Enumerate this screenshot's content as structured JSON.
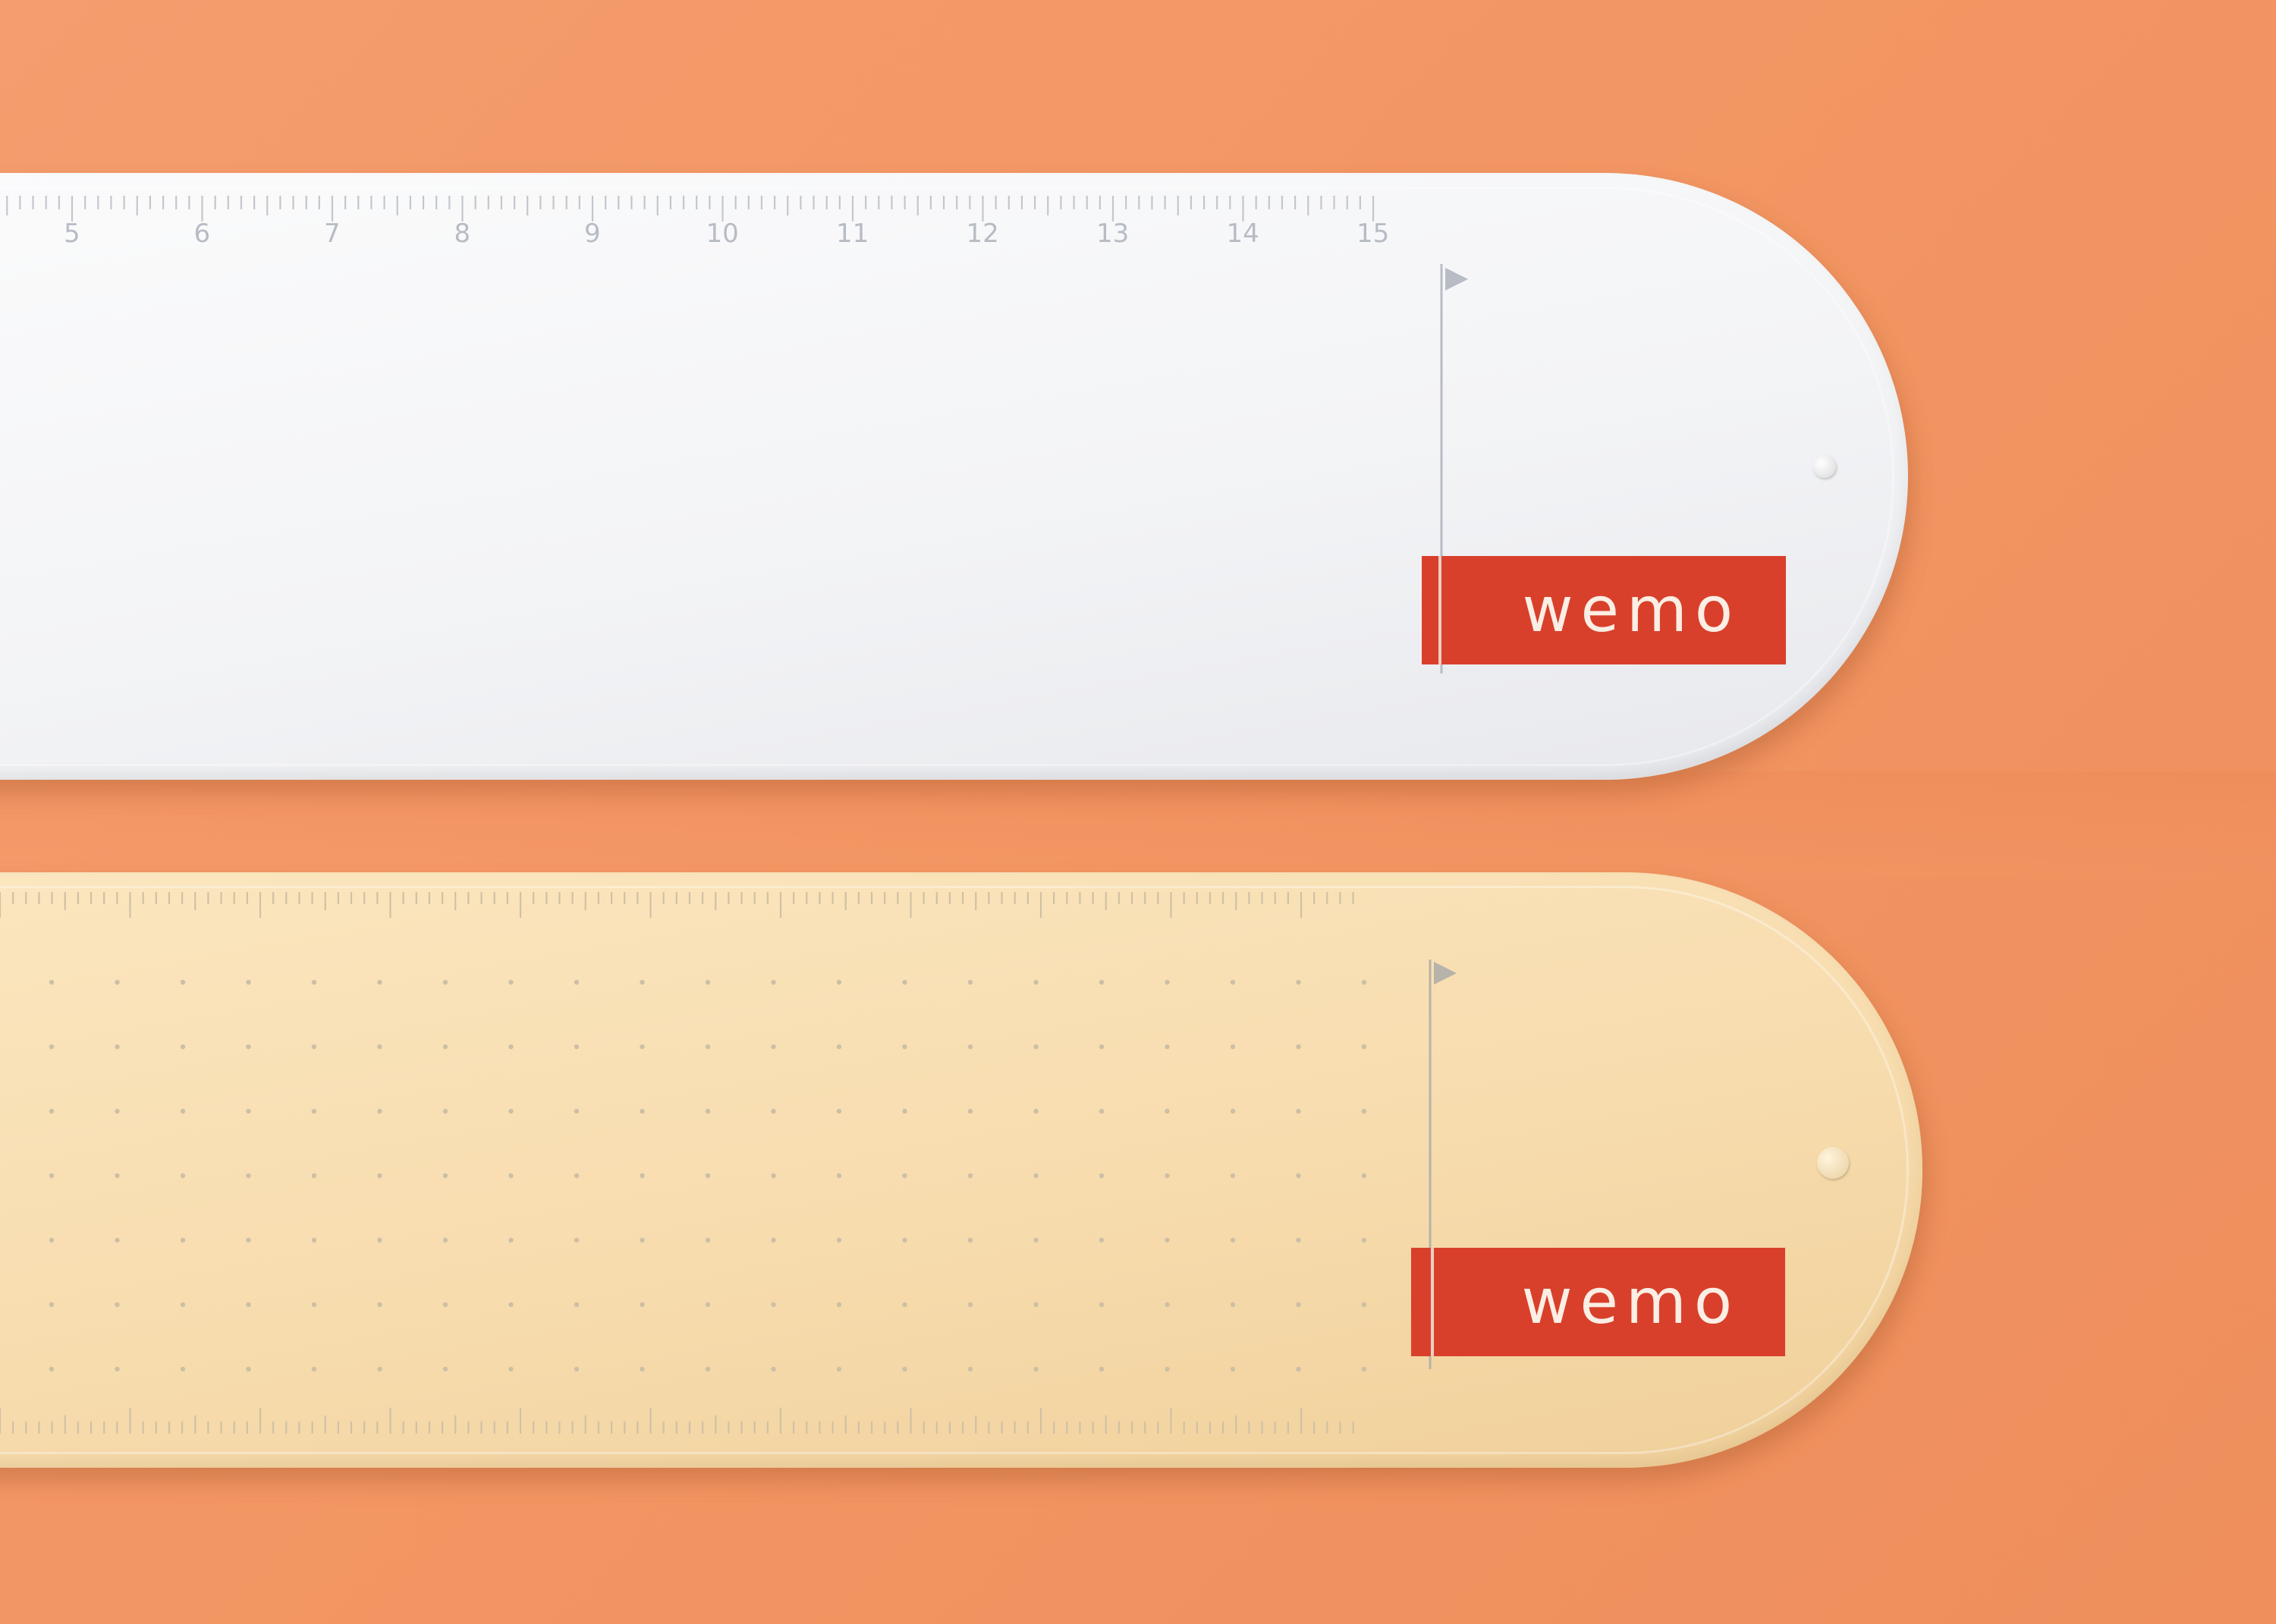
{
  "rulers": [
    {
      "name": "white ruler",
      "color": "#f3f4f6",
      "scale_numbers": [
        "5",
        "6",
        "7",
        "8",
        "9",
        "10",
        "11",
        "12",
        "13",
        "14",
        "15"
      ],
      "brand": "wemo",
      "brand_color": "#d8402b"
    },
    {
      "name": "cream ruler",
      "color": "#f7dcae",
      "brand": "wemo",
      "brand_color": "#d8402b",
      "pattern": "dot grid"
    }
  ],
  "background_color": "#f29663"
}
